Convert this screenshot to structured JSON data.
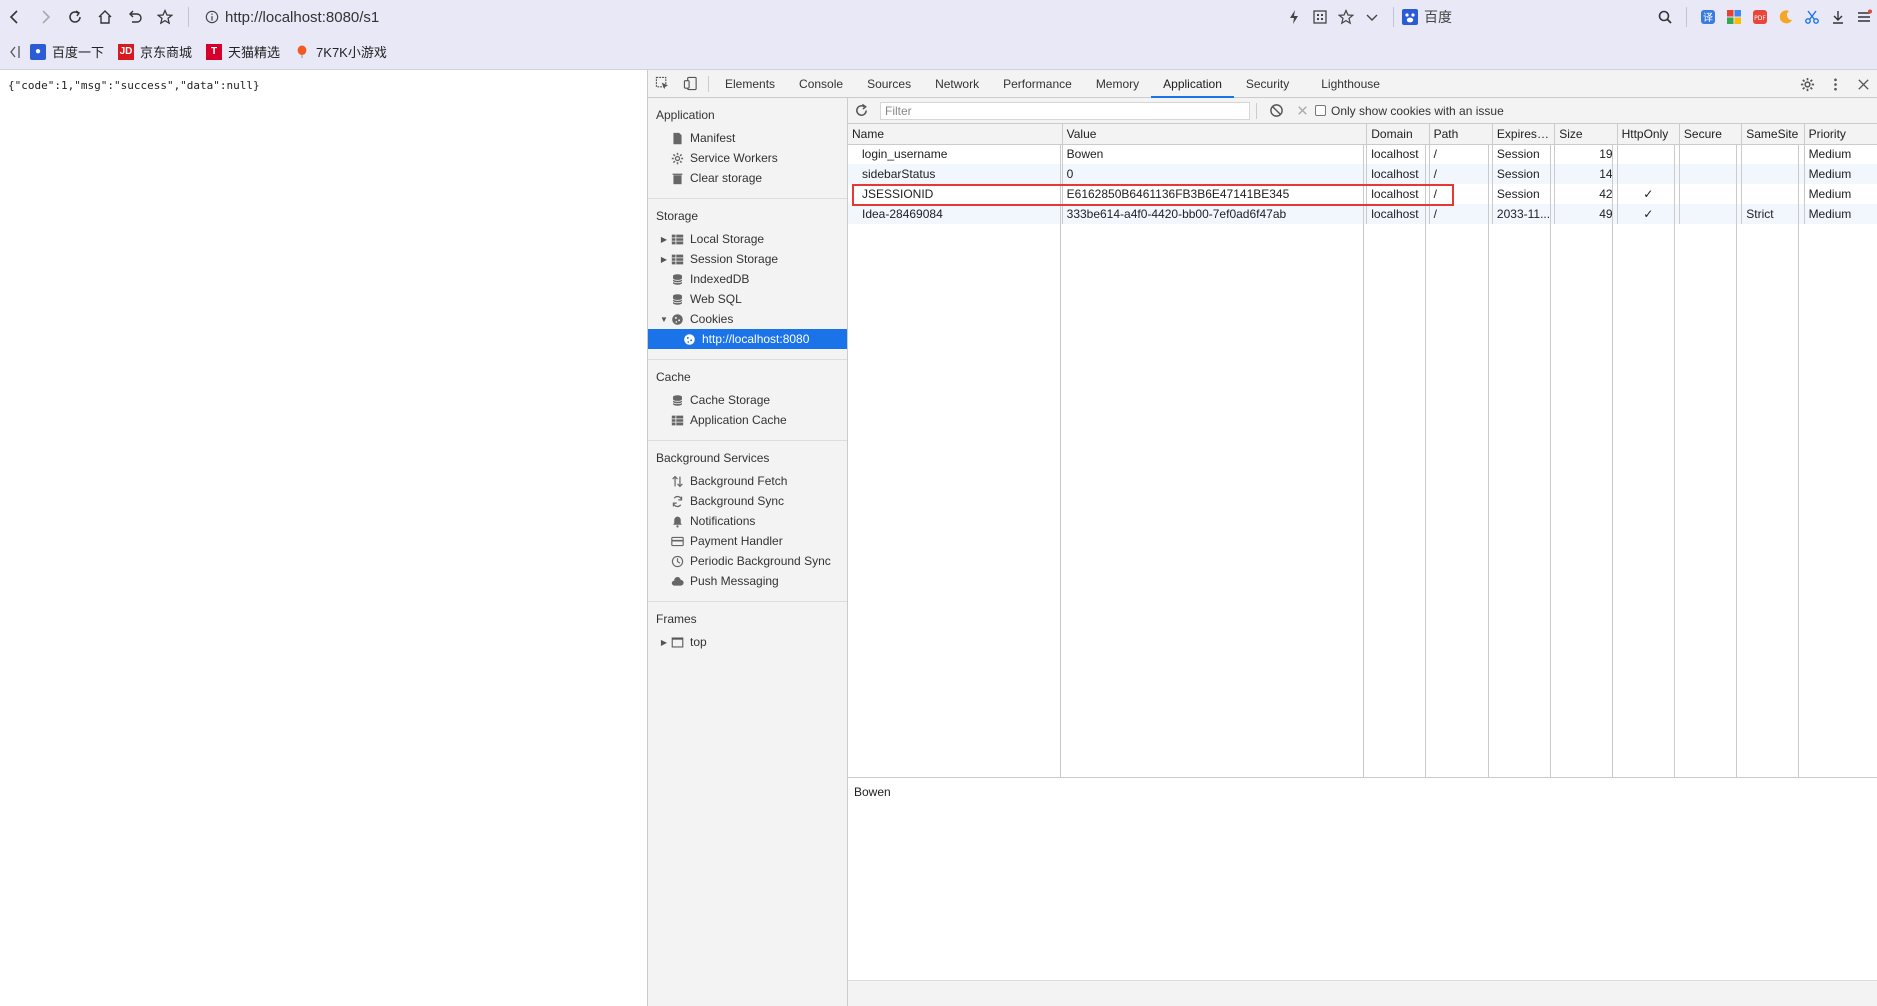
{
  "browser": {
    "url": "http://localhost:8080/s1",
    "search_engine_label": "百度",
    "bookmarks": [
      {
        "label": "百度一下",
        "icon": "baidu-paw-icon"
      },
      {
        "label": "京东商城",
        "icon": "jd-icon"
      },
      {
        "label": "天猫精选",
        "icon": "tmall-icon"
      },
      {
        "label": "7K7K小游戏",
        "icon": "balloon-icon"
      }
    ]
  },
  "page": {
    "content": "{\"code\":1,\"msg\":\"success\",\"data\":null}"
  },
  "devtools": {
    "tabs": [
      "Elements",
      "Console",
      "Sources",
      "Network",
      "Performance",
      "Memory",
      "Application",
      "Security",
      "Lighthouse"
    ],
    "active_tab": "Application",
    "sidebar": {
      "application_title": "Application",
      "application_items": [
        "Manifest",
        "Service Workers",
        "Clear storage"
      ],
      "storage_title": "Storage",
      "storage_items": [
        "Local Storage",
        "Session Storage",
        "IndexedDB",
        "Web SQL",
        "Cookies",
        "http://localhost:8080"
      ],
      "cache_title": "Cache",
      "cache_items": [
        "Cache Storage",
        "Application Cache"
      ],
      "bg_title": "Background Services",
      "bg_items": [
        "Background Fetch",
        "Background Sync",
        "Notifications",
        "Payment Handler",
        "Periodic Background Sync",
        "Push Messaging"
      ],
      "frames_title": "Frames",
      "frames_items": [
        "top"
      ]
    },
    "toolbar": {
      "filter_placeholder": "Filter",
      "only_issue_label": "Only show cookies with an issue"
    },
    "cookies": {
      "columns": [
        "Name",
        "Value",
        "Domain",
        "Path",
        "Expires ...",
        "Size",
        "HttpOnly",
        "Secure",
        "SameSite",
        "Priority"
      ],
      "rows": [
        {
          "name": "login_username",
          "value": "Bowen",
          "domain": "localhost",
          "path": "/",
          "expires": "Session",
          "size": "19",
          "httponly": "",
          "secure": "",
          "samesite": "",
          "priority": "Medium"
        },
        {
          "name": "sidebarStatus",
          "value": "0",
          "domain": "localhost",
          "path": "/",
          "expires": "Session",
          "size": "14",
          "httponly": "",
          "secure": "",
          "samesite": "",
          "priority": "Medium"
        },
        {
          "name": "JSESSIONID",
          "value": "E6162850B6461136FB3B6E47141BE345",
          "domain": "localhost",
          "path": "/",
          "expires": "Session",
          "size": "42",
          "httponly": "✓",
          "secure": "",
          "samesite": "",
          "priority": "Medium"
        },
        {
          "name": "Idea-28469084",
          "value": "333be614-a4f0-4420-bb00-7ef0ad6f47ab",
          "domain": "localhost",
          "path": "/",
          "expires": "2033-11...",
          "size": "49",
          "httponly": "✓",
          "secure": "",
          "samesite": "Strict",
          "priority": "Medium"
        }
      ],
      "highlight_color": "#e53935"
    },
    "preview": {
      "value": "Bowen"
    }
  }
}
